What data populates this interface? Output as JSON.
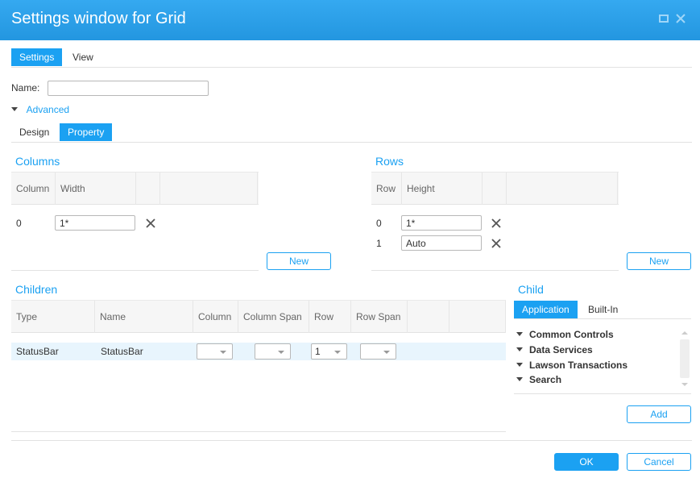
{
  "window": {
    "title": "Settings window for Grid",
    "icons": {
      "maximize": "maximize-icon",
      "close": "close-icon"
    }
  },
  "main_tabs": [
    {
      "label": "Settings",
      "active": true
    },
    {
      "label": "View",
      "active": false
    }
  ],
  "name_field": {
    "label": "Name:",
    "value": "",
    "placeholder": ""
  },
  "advanced": {
    "label": "Advanced",
    "expanded": true,
    "icon": "triangle-down-icon"
  },
  "sub_tabs": [
    {
      "label": "Design",
      "active": false
    },
    {
      "label": "Property",
      "active": true
    }
  ],
  "columns": {
    "title": "Columns",
    "headers": [
      "Column",
      "Width",
      "",
      ""
    ],
    "rows": [
      {
        "index": "0",
        "width": "1*"
      }
    ],
    "delete_icon": "x-icon",
    "new_label": "New"
  },
  "rows": {
    "title": "Rows",
    "headers": [
      "Row",
      "Height",
      "",
      ""
    ],
    "rows": [
      {
        "index": "0",
        "height": "1*"
      },
      {
        "index": "1",
        "height": "Auto"
      }
    ],
    "delete_icon": "x-icon",
    "new_label": "New"
  },
  "children": {
    "title": "Children",
    "headers": [
      "Type",
      "Name",
      "Column",
      "Column Span",
      "Row",
      "Row Span",
      "",
      ""
    ],
    "rows": [
      {
        "type": "StatusBar",
        "name": "StatusBar",
        "column": "",
        "column_span": "",
        "row": "1",
        "row_span": ""
      }
    ]
  },
  "child": {
    "title": "Child",
    "tabs": [
      {
        "label": "Application",
        "active": true
      },
      {
        "label": "Built-In",
        "active": false
      }
    ],
    "tree": [
      {
        "label": "Common Controls"
      },
      {
        "label": "Data Services"
      },
      {
        "label": "Lawson Transactions"
      },
      {
        "label": "Search"
      }
    ],
    "add_label": "Add"
  },
  "footer": {
    "ok_label": "OK",
    "cancel_label": "Cancel"
  },
  "colors": {
    "accent": "#1ba1f2",
    "titlebar": "#2a9fe8",
    "selected_row": "#e8f5fd"
  }
}
